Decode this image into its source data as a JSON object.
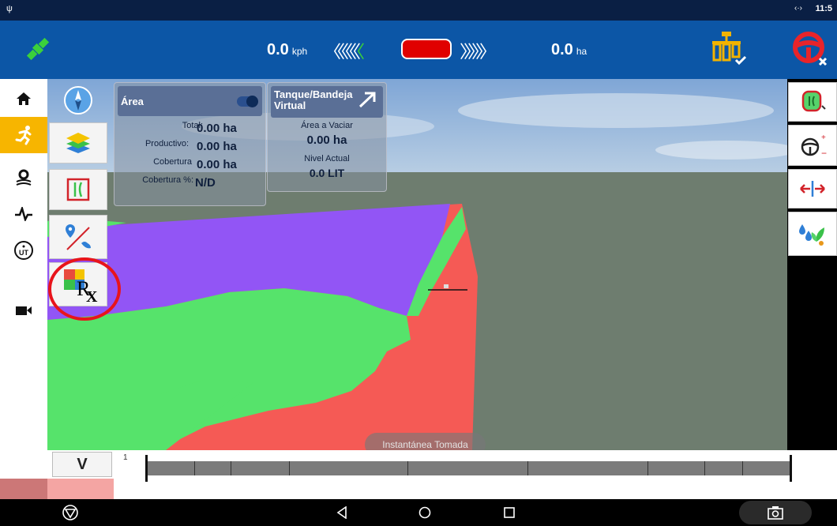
{
  "status_bar": {
    "usb_symbol": "ψ",
    "network": "‹·›",
    "clock": "11:5"
  },
  "top_bar": {
    "speed_value": "0.0",
    "speed_unit": "kph",
    "area_value": "0.0",
    "area_unit": "ha",
    "left_chevrons": "〈〈〈〈〈〈",
    "left_active_chevron": "〈",
    "right_chevrons": "〉〉〉〉〉〉",
    "indicator_color": "#e00000"
  },
  "left_nav": {
    "items": [
      {
        "name": "home",
        "glyph": "⌂"
      },
      {
        "name": "run",
        "glyph": "🏃",
        "active": true
      },
      {
        "name": "settings",
        "glyph": "⚙"
      },
      {
        "name": "diagnostics",
        "glyph": "⁓"
      },
      {
        "name": "universal-terminal",
        "glyph": "UT"
      },
      {
        "name": "camera",
        "glyph": "■"
      }
    ]
  },
  "area_panel": {
    "title": "Área",
    "rows": [
      {
        "label": "Total:",
        "value": "0.00 ha"
      },
      {
        "label": "Productivo:",
        "value": "0.00 ha"
      },
      {
        "label": "Cobertura",
        "value": "0.00 ha"
      },
      {
        "label": "Cobertura %:",
        "value": "N/D"
      }
    ]
  },
  "tank_panel": {
    "title_line1": "Tanque/Bandeja",
    "title_line2": "Virtual",
    "area_label": "Área a Vaciar",
    "area_value": "0.00 ha",
    "level_label": "Nivel Actual",
    "level_value": "0.0 LIT"
  },
  "rx_label": "R",
  "rx_sub": "X",
  "toast": "Instantánea Tomada",
  "bottom_bar": {
    "view_button": "V",
    "timeline_start": "1"
  },
  "colors": {
    "topbar": "#0c56a6",
    "purple": "#9255f5",
    "green": "#56e36b",
    "red": "#f55a55",
    "highlight_circle": "#e8141b"
  }
}
